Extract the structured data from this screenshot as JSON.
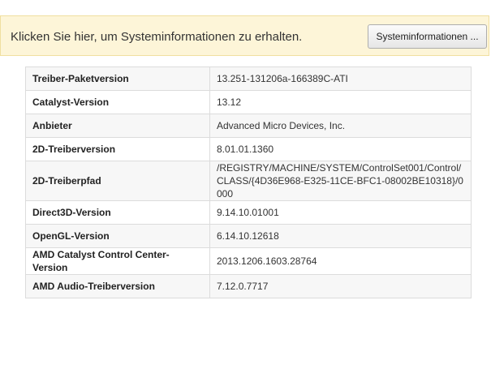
{
  "info_bar": {
    "message": "Klicken Sie hier, um Systeminformationen zu erhalten.",
    "button_label": "Systeminformationen ..."
  },
  "driver_info": {
    "rows": [
      {
        "label": "Treiber-Paketversion",
        "value": "13.251-131206a-166389C-ATI"
      },
      {
        "label": "Catalyst-Version",
        "value": "13.12"
      },
      {
        "label": "Anbieter",
        "value": "Advanced Micro Devices, Inc."
      },
      {
        "label": "2D-Treiberversion",
        "value": "8.01.01.1360"
      },
      {
        "label": "2D-Treiberpfad",
        "value": "/REGISTRY/MACHINE/SYSTEM/ControlSet001/Control/CLASS/{4D36E968-E325-11CE-BFC1-08002BE10318}/0000"
      },
      {
        "label": "Direct3D-Version",
        "value": "9.14.10.01001"
      },
      {
        "label": "OpenGL-Version",
        "value": "6.14.10.12618"
      },
      {
        "label": "AMD Catalyst Control Center-Version",
        "value": "2013.1206.1603.28764"
      },
      {
        "label": "AMD Audio-Treiberversion",
        "value": "7.12.0.7717"
      }
    ]
  }
}
